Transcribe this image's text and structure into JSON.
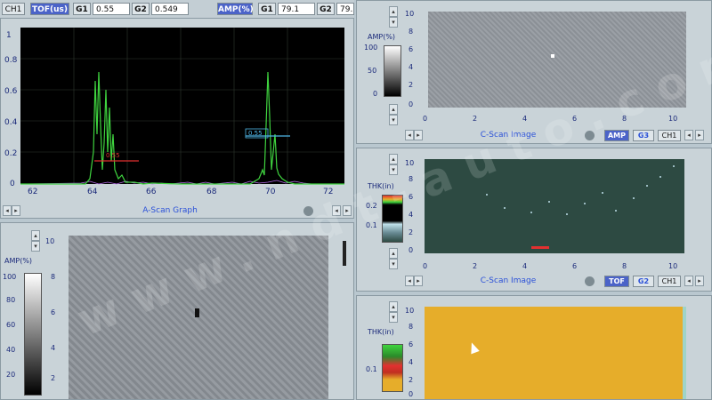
{
  "toolbar": {
    "channel": "CH1",
    "tof_label": "TOF(us)",
    "g1_label": "G1",
    "g1_value": "0.55",
    "g2_label": "G2",
    "g2_value": "0.549",
    "amp_label": "AMP(%)",
    "amp_g1_label": "G1",
    "amp_g1_value": "79.1",
    "amp_g2_label": "G2",
    "amp_g2_value": "79."
  },
  "ascan": {
    "caption": "A-Scan Graph",
    "marker1_label": "0.55",
    "marker2_label": "0.55",
    "x_ticks": [
      "62",
      "64",
      "66",
      "68",
      "70",
      "72"
    ],
    "y_ticks": [
      "0",
      "0.2",
      "0.4",
      "0.6",
      "0.8",
      "1"
    ]
  },
  "cscan_amp": {
    "scale_label": "AMP(%)",
    "scale_ticks": [
      "100",
      "50",
      "0"
    ],
    "y_ticks": [
      "0",
      "2",
      "4",
      "6",
      "8",
      "10"
    ],
    "x_ticks": [
      "0",
      "2",
      "4",
      "6",
      "8",
      "10"
    ],
    "caption": "C-Scan Image",
    "mode_button": "AMP",
    "gate_button": "G3",
    "channel_button": "CH1"
  },
  "cscan_tof": {
    "scale_label": "THK(in)",
    "scale_ticks": [
      "0.2",
      "0.1"
    ],
    "y_ticks": [
      "0",
      "2",
      "4",
      "6",
      "8",
      "10"
    ],
    "x_ticks": [
      "0",
      "2",
      "4",
      "6",
      "8",
      "10"
    ],
    "caption": "C-Scan Image",
    "mode_button": "TOF",
    "gate_button": "G2",
    "channel_button": "CH1"
  },
  "bscan_amp": {
    "scale_label": "AMP(%)",
    "scale_ticks": [
      "100",
      "80",
      "60",
      "40",
      "20"
    ],
    "y_ticks": [
      "2",
      "4",
      "6",
      "8",
      "10"
    ]
  },
  "thk_map": {
    "scale_label": "THK(in)",
    "scale_ticks": [
      "0.1"
    ],
    "y_ticks": [
      "0",
      "2",
      "4",
      "6",
      "8",
      "10"
    ]
  },
  "watermark": "www.ndt-auto.com",
  "colors": {
    "ascan_bg": "#000000",
    "signal_green": "#3fd43f",
    "gate_cyan": "#4fb8e8",
    "gate_red": "#e23030",
    "tof_bg": "#2d4a42",
    "thk_fill": "#e6ad2a"
  }
}
